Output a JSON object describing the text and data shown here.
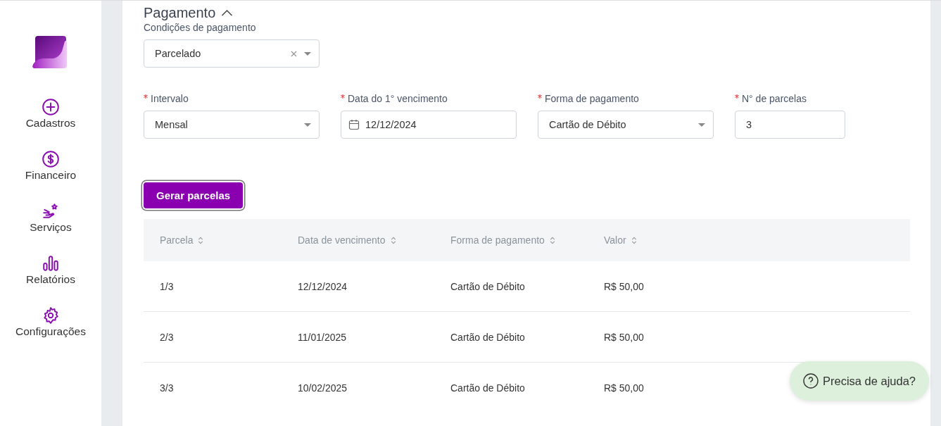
{
  "sidebar": {
    "items": [
      {
        "label": "Cadastros"
      },
      {
        "label": "Financeiro"
      },
      {
        "label": "Serviços"
      },
      {
        "label": "Relatórios"
      },
      {
        "label": "Configurações"
      }
    ]
  },
  "section": {
    "title": "Pagamento",
    "expanded": true
  },
  "payment_condition": {
    "label": "Condições de pagamento",
    "value": "Parcelado",
    "kind": "select",
    "clearable": true
  },
  "fields": [
    {
      "label": "Intervalo",
      "value": "Mensal",
      "kind": "select",
      "required": true
    },
    {
      "label": "Data do 1° vencimento",
      "value": "12/12/2024",
      "kind": "date",
      "required": true
    },
    {
      "label": "Forma de pagamento",
      "value": "Cartão de Débito",
      "kind": "select",
      "required": true
    },
    {
      "label": "N° de parcelas",
      "value": "3",
      "kind": "input",
      "required": true
    }
  ],
  "generate_button": "Gerar parcelas",
  "table": {
    "columns": [
      "Parcela",
      "Data de vencimento",
      "Forma de pagamento",
      "Valor"
    ],
    "rows": [
      [
        "1/3",
        "12/12/2024",
        "Cartão de Débito",
        "R$ 50,00"
      ],
      [
        "2/3",
        "11/01/2025",
        "Cartão de Débito",
        "R$ 50,00"
      ],
      [
        "3/3",
        "10/02/2025",
        "Cartão de Débito",
        "R$ 50,00"
      ]
    ]
  },
  "help_button": "Precisa de ajuda?"
}
